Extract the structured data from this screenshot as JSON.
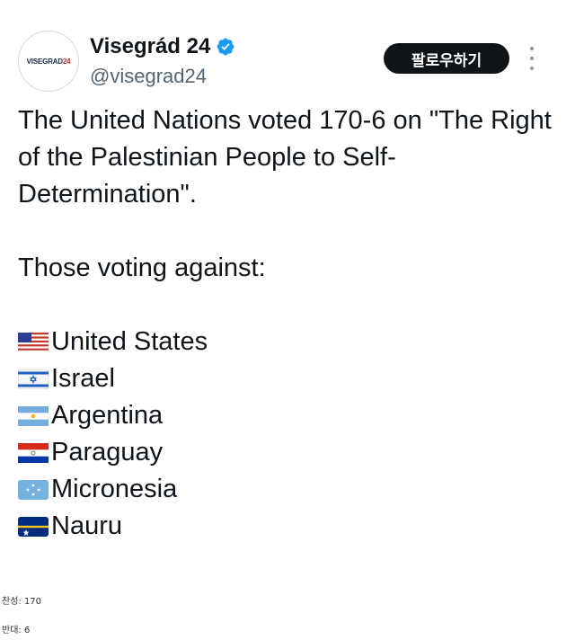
{
  "account": {
    "display_name": "Visegrád 24",
    "handle": "@visegrad24",
    "avatar_text_main": "VISEGRAD",
    "avatar_text_num": "24",
    "verified_icon": "verified-badge-icon"
  },
  "actions": {
    "follow_label": "팔로우하기",
    "more_icon": "more-dots-icon"
  },
  "tweet": {
    "line1": "The United Nations voted 170-6 on \"The Right of the Palestinian People to Self-Determination\".",
    "line2": "Those voting against:",
    "countries": [
      {
        "flag": "us-flag-icon",
        "name": "United States"
      },
      {
        "flag": "israel-flag-icon",
        "name": "Israel"
      },
      {
        "flag": "argentina-flag-icon",
        "name": "Argentina"
      },
      {
        "flag": "paraguay-flag-icon",
        "name": "Paraguay"
      },
      {
        "flag": "micronesia-flag-icon",
        "name": "Micronesia"
      },
      {
        "flag": "nauru-flag-icon",
        "name": "Nauru"
      }
    ]
  },
  "footer": {
    "for_text": "찬성: 170",
    "against_text": "반대: 6"
  },
  "colors": {
    "follow_bg": "#0f1419",
    "verified_blue": "#1d9bf0",
    "handle_gray": "#536471"
  }
}
